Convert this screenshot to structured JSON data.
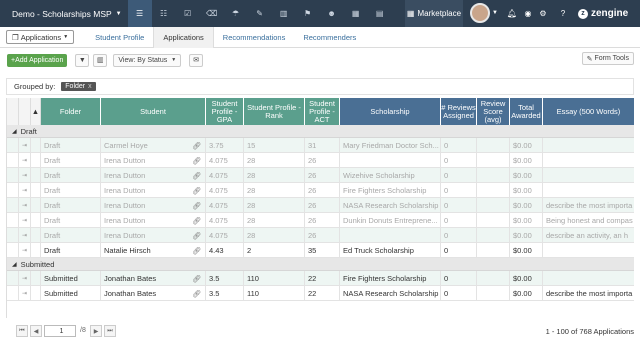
{
  "topnav": {
    "workspace": "Demo - Scholarships MSP",
    "icons": [
      "database-icon",
      "chat-icon",
      "tasks-icon",
      "trash-icon",
      "handshake-icon",
      "edit-icon",
      "columns-icon",
      "flag-icon",
      "users-icon",
      "calendar-icon",
      "chart-icon"
    ],
    "marketplace": "Marketplace",
    "brand": "zengine",
    "colors": {
      "bar": "#2d3e50",
      "active": "#3d5a78"
    }
  },
  "subnav": {
    "app_select": "Applications",
    "tabs": [
      "Student Profile",
      "Applications",
      "Recommendations",
      "Recommenders"
    ],
    "active_tab": 1
  },
  "toolbar": {
    "add": "+Add Application",
    "view": "View: By Status",
    "form_tools": "Form Tools"
  },
  "grouping": {
    "label": "Grouped by:",
    "chip": "Folder",
    "remove": "x"
  },
  "columns": [
    "Folder",
    "Student",
    "Student Profile - GPA",
    "Student Profile - Rank",
    "Student Profile - ACT",
    "Scholarship",
    "# Reviews Assigned",
    "Review Score (avg)",
    "Total Awarded",
    "Essay (500 Words)"
  ],
  "groups": [
    {
      "name": "Draft",
      "rows": [
        {
          "folder": "Draft",
          "student": "Carmel Hoye",
          "gpa": "3.75",
          "rank": "15",
          "act": "31",
          "scholarship": "Mary Friedman Doctor Sch...",
          "reviews": "0",
          "score": "",
          "awarded": "$0.00",
          "essay": "",
          "faded": true
        },
        {
          "folder": "Draft",
          "student": "Irena Dutton",
          "gpa": "4.075",
          "rank": "28",
          "act": "26",
          "scholarship": "",
          "reviews": "0",
          "score": "",
          "awarded": "$0.00",
          "essay": "",
          "faded": true
        },
        {
          "folder": "Draft",
          "student": "Irena Dutton",
          "gpa": "4.075",
          "rank": "28",
          "act": "26",
          "scholarship": "Wizehive Scholarship",
          "reviews": "0",
          "score": "",
          "awarded": "$0.00",
          "essay": "",
          "faded": true
        },
        {
          "folder": "Draft",
          "student": "Irena Dutton",
          "gpa": "4.075",
          "rank": "28",
          "act": "26",
          "scholarship": "Fire Fighters Scholarship",
          "reviews": "0",
          "score": "",
          "awarded": "$0.00",
          "essay": "",
          "faded": true
        },
        {
          "folder": "Draft",
          "student": "Irena Dutton",
          "gpa": "4.075",
          "rank": "28",
          "act": "26",
          "scholarship": "NASA Research Scholarship",
          "reviews": "0",
          "score": "",
          "awarded": "$0.00",
          "essay": "describe the most importa",
          "faded": true
        },
        {
          "folder": "Draft",
          "student": "Irena Dutton",
          "gpa": "4.075",
          "rank": "28",
          "act": "26",
          "scholarship": "Dunkin Donuts Entreprene...",
          "reviews": "0",
          "score": "",
          "awarded": "$0.00",
          "essay": "Being honest and compas",
          "faded": true
        },
        {
          "folder": "Draft",
          "student": "Irena Dutton",
          "gpa": "4.075",
          "rank": "28",
          "act": "26",
          "scholarship": "",
          "reviews": "0",
          "score": "",
          "awarded": "$0.00",
          "essay": "describe an activity, an h",
          "faded": true
        },
        {
          "folder": "Draft",
          "student": "Natalie Hirsch",
          "gpa": "4.43",
          "rank": "2",
          "act": "35",
          "scholarship": "Ed Truck Scholarship",
          "reviews": "0",
          "score": "",
          "awarded": "$0.00",
          "essay": "",
          "faded": false
        }
      ]
    },
    {
      "name": "Submitted",
      "rows": [
        {
          "folder": "Submitted",
          "student": "Jonathan Bates",
          "gpa": "3.5",
          "rank": "110",
          "act": "22",
          "scholarship": "Fire Fighters Scholarship",
          "reviews": "0",
          "score": "",
          "awarded": "$0.00",
          "essay": "",
          "faded": false
        },
        {
          "folder": "Submitted",
          "student": "Jonathan Bates",
          "gpa": "3.5",
          "rank": "110",
          "act": "22",
          "scholarship": "NASA Research Scholarship",
          "reviews": "0",
          "score": "",
          "awarded": "$0.00",
          "essay": "describe the most importa",
          "faded": false
        }
      ]
    }
  ],
  "pager": {
    "page": "1",
    "of": "/8",
    "info": "1 - 100 of 768 Applications"
  }
}
